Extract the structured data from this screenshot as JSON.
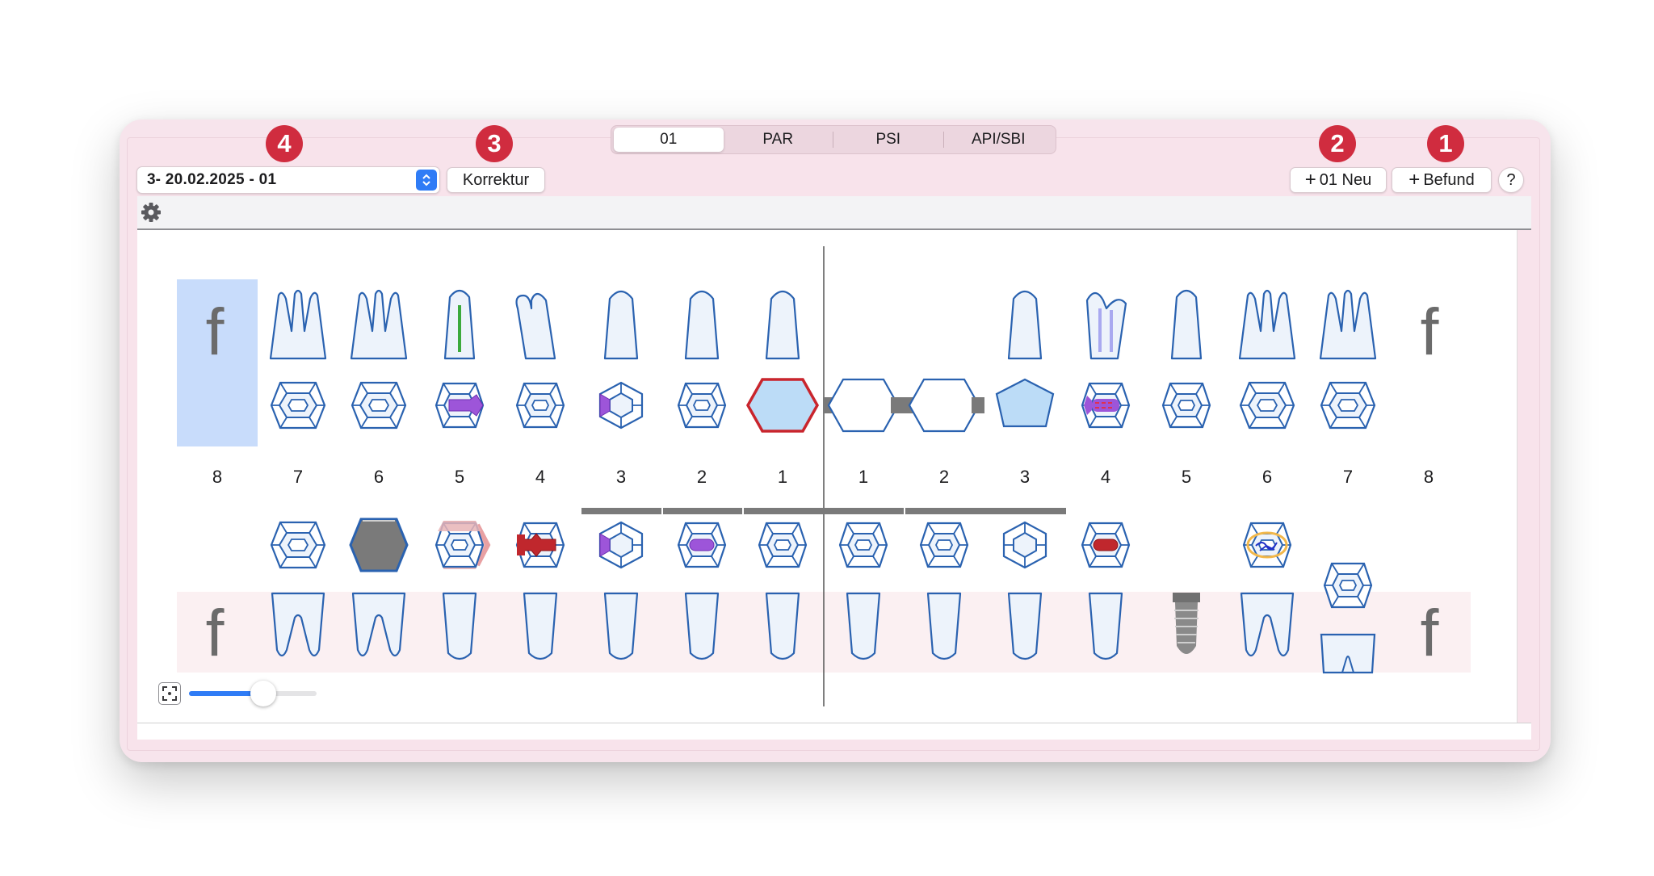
{
  "tabs": [
    {
      "label": "01",
      "active": true
    },
    {
      "label": "PAR",
      "active": false
    },
    {
      "label": "PSI",
      "active": false
    },
    {
      "label": "API/SBI",
      "active": false
    }
  ],
  "selector": {
    "prefix": "3",
    "value": " - 20.02.2025 - 01"
  },
  "buttons": {
    "korrektur": "Korrektur",
    "neu": "01 Neu",
    "befund": "Befund",
    "help": "?"
  },
  "badges": {
    "b1": "1",
    "b2": "2",
    "b3": "3",
    "b4": "4"
  },
  "icons": {
    "settings": "gear-icon",
    "fit": "fit-to-screen-icon",
    "select_arrows": "chevron-up-down-icon"
  },
  "colors": {
    "badge": "#d02c3f",
    "tooth_outline": "#2a62b0",
    "tooth_fill": "#edf3fb",
    "selection": "#c8dcfb",
    "filling_purple": "#9d55d9",
    "filling_red": "#c0272d",
    "bridge_gray": "#7a7a7a"
  },
  "chart": {
    "upper_numbers": [
      "8",
      "7",
      "6",
      "5",
      "4",
      "3",
      "2",
      "1",
      "1",
      "2",
      "3",
      "4",
      "5",
      "6",
      "7",
      "8"
    ],
    "upper_missing_label": "f",
    "lower_missing_label": "f",
    "zoom_level": 0.55
  }
}
